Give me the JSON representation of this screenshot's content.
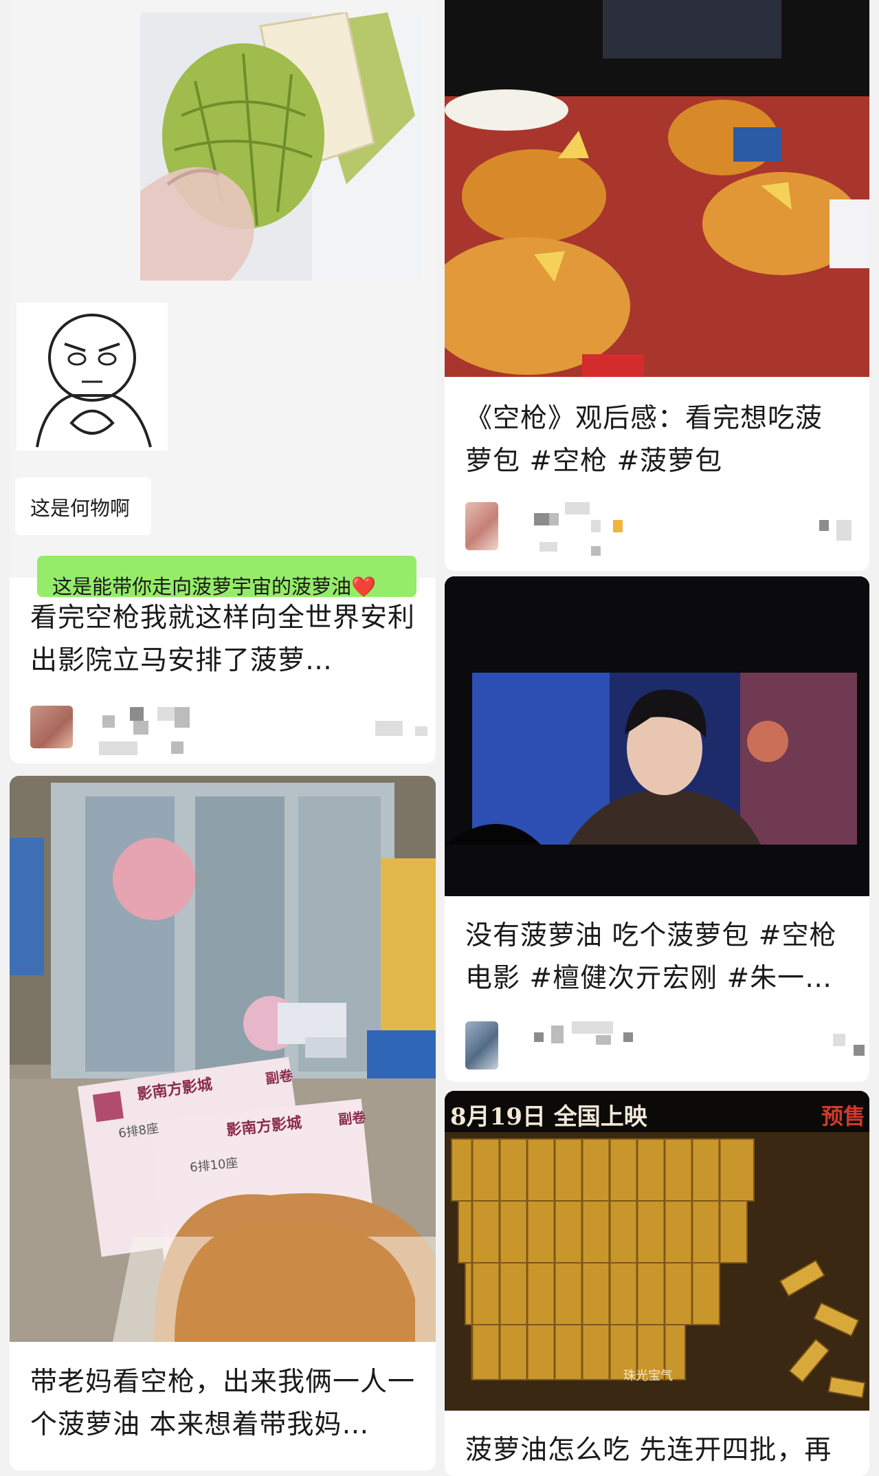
{
  "feed": {
    "left": [
      {
        "title": "看完空枪我就这样向全世界安利 出影院立马安排了菠萝…",
        "chat": {
          "question": "这是何物啊",
          "reply": "这是能带你走向菠萝宇宙的菠萝油❤️"
        }
      },
      {
        "title": "带老妈看空枪，出来我俩一人一个菠萝油 本来想着带我妈…",
        "tickets": [
          {
            "cinema": "影南方影城",
            "seat": "6排8座",
            "stub": "副卷"
          },
          {
            "cinema": "影南方影城",
            "seat": "6排10座",
            "stub": "副卷"
          }
        ]
      }
    ],
    "right": [
      {
        "title": "《空枪》观后感：看完想吃菠萝包 #空枪 #菠萝包"
      },
      {
        "title": "没有菠萝油 吃个菠萝包 #空枪电影 #檀健次亓宏刚 #朱一…"
      },
      {
        "title": "菠萝油怎么吃 先连开四批，再",
        "poster": {
          "release": "8月19日 全国上映",
          "presale": "预售",
          "caption": "珠光宝气"
        }
      }
    ]
  },
  "colors": {
    "background": "#f2f2f3",
    "card": "#ffffff",
    "chat_green": "#95ec69",
    "gold": "#c9962c"
  }
}
